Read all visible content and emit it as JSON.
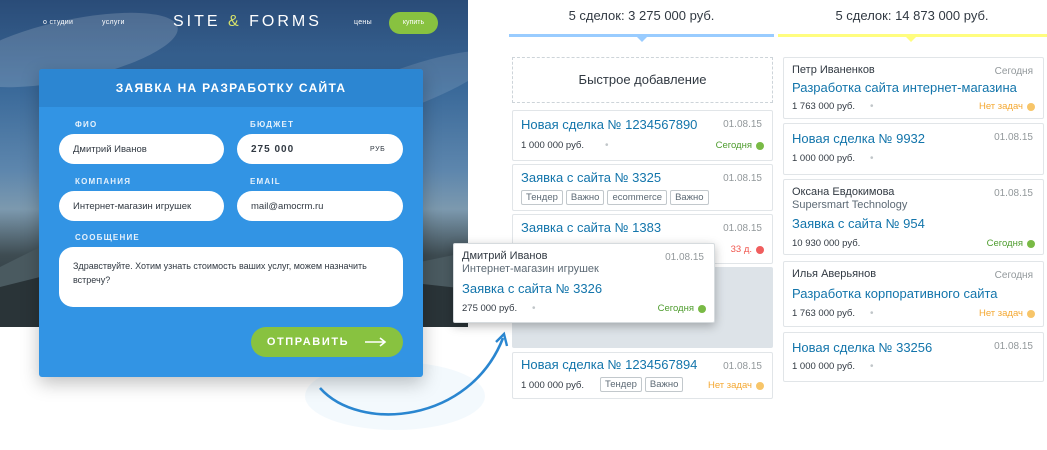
{
  "site": {
    "nav": {
      "about": "о студии",
      "services": "услуги",
      "logo_part1": "SITE",
      "logo_amp": "&",
      "logo_part2": "FORMS",
      "prices": "цены",
      "buy": "купить"
    },
    "form": {
      "title": "ЗАЯВКА НА РАЗРАБОТКУ САЙТА",
      "name_label": "ФИО",
      "name_value": "Дмитрий Иванов",
      "budget_label": "БЮДЖЕТ",
      "budget_value": "275 000",
      "currency": "РУБ",
      "company_label": "КОМПАНИЯ",
      "company_value": "Интернет-магазин игрушек",
      "email_label": "EMAIL",
      "email_value": "mail@amocrm.ru",
      "message_label": "СООБЩЕНИЕ",
      "message_value": "Здравствуйте. Хотим узнать стоимость ваших услуг, можем назначить встречу?",
      "submit": "ОТПРАВИТЬ"
    }
  },
  "colors": {
    "form_blue": "#3294e4",
    "accent_green": "#88c240",
    "deal_link": "#1375ab",
    "stage1_bar": "#99ccff",
    "stage2_bar": "#fffd7f"
  },
  "pipeline": {
    "columns": [
      {
        "header": "5 сделок: 3 275 000 руб.",
        "quick_add": "Быстрое добавление",
        "cards": [
          {
            "deal": "Новая сделка № 1234567890",
            "date": "01.08.15",
            "price": "1 000 000 руб.",
            "status": "Сегодня"
          },
          {
            "deal": "Заявка с сайта № 3325",
            "date": "01.08.15",
            "tags": [
              "Тендер",
              "Важно",
              "ecommerce",
              "Важно"
            ]
          },
          {
            "deal": "Заявка с сайта № 1383",
            "date": "01.08.15",
            "status": "33 д."
          },
          {
            "deal": "Новая сделка № 1234567894",
            "date": "01.08.15",
            "price": "1 000 000 руб.",
            "tags": [
              "Тендер",
              "Важно"
            ],
            "status": "Нет задач"
          }
        ]
      },
      {
        "header": "5 сделок: 14 873 000 руб.",
        "cards": [
          {
            "contact": "Петр Иваненков",
            "date": "Сегодня",
            "deal": "Разработка сайта интернет-магазина",
            "price": "1 763 000 руб.",
            "status": "Нет задач"
          },
          {
            "deal": "Новая сделка № 9932",
            "date": "01.08.15",
            "price": "1 000 000 руб."
          },
          {
            "contact": "Оксана Евдокимова",
            "company": "Supersmart Technology",
            "date": "01.08.15",
            "deal": "Заявка с сайта № 954",
            "price": "10 930 000 руб.",
            "status": "Сегодня"
          },
          {
            "contact": "Илья Аверьянов",
            "date": "Сегодня",
            "deal": "Разработка корпоративного сайта",
            "price": "1 763 000 руб.",
            "status": "Нет задач"
          },
          {
            "deal": "Новая сделка № 33256",
            "date": "01.08.15",
            "price": "1 000 000 руб."
          }
        ]
      }
    ],
    "dragged_card": {
      "contact": "Дмитрий Иванов",
      "company": "Интернет-магазин игрушек",
      "date": "01.08.15",
      "deal": "Заявка с сайта № 3326",
      "price": "275 000 руб.",
      "status": "Сегодня"
    },
    "separator": "•"
  }
}
